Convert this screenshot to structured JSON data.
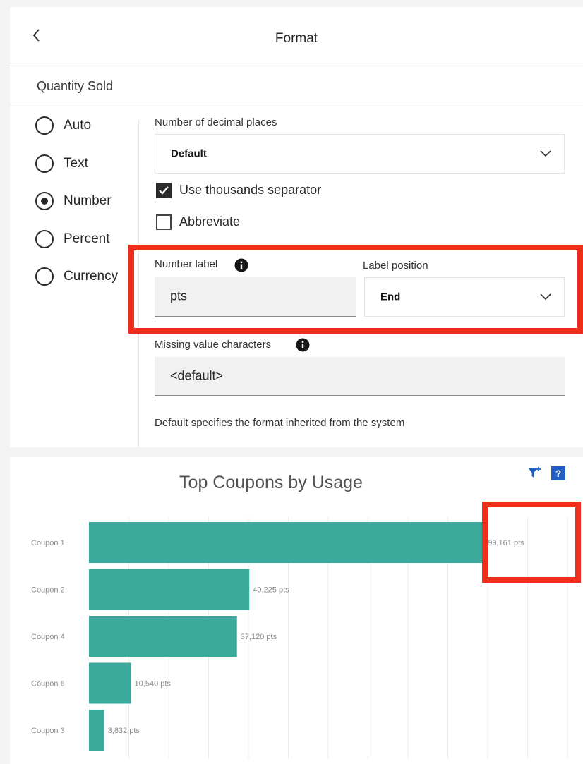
{
  "format_panel": {
    "title": "Format",
    "section": "Quantity Sold",
    "format_options": [
      "Auto",
      "Text",
      "Number",
      "Percent",
      "Currency"
    ],
    "selected_format": "Number",
    "decimal_places": {
      "label": "Number of decimal places",
      "value": "Default"
    },
    "thousands_separator": {
      "label": "Use thousands separator",
      "checked": true
    },
    "abbreviate": {
      "label": "Abbreviate",
      "checked": false
    },
    "number_label": {
      "label": "Number label",
      "value": "pts"
    },
    "label_position": {
      "label": "Label position",
      "value": "End"
    },
    "missing_value": {
      "label": "Missing value characters",
      "value": "<default>"
    },
    "help_text": "Default specifies the format inherited from the system"
  },
  "chart": {
    "icons": [
      "filter-icon",
      "help-icon"
    ],
    "highlight_color": "#ee2d1c"
  },
  "chart_data": {
    "type": "bar",
    "orientation": "horizontal",
    "title": "Top Coupons by Usage",
    "categories": [
      "Coupon 1",
      "Coupon 2",
      "Coupon 4",
      "Coupon 6",
      "Coupon 3"
    ],
    "values": [
      99161,
      40225,
      37120,
      10540,
      3832
    ],
    "value_labels": [
      "99,161 pts",
      "40,225 pts",
      "37,120 pts",
      "10,540 pts",
      "3,832 pts"
    ],
    "xlim": [
      0,
      120000
    ],
    "grid": true,
    "bar_color": "#3ba99c"
  }
}
